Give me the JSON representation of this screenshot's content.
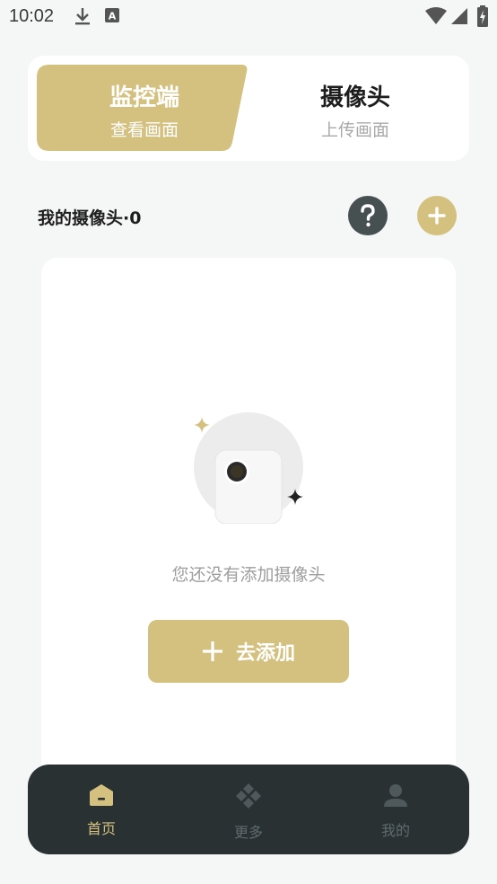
{
  "status_bar": {
    "time": "10:02",
    "icons": [
      "download-icon",
      "keyboard-a-icon",
      "wifi-icon",
      "signal-icon",
      "battery-charging-icon"
    ]
  },
  "mode_switch": {
    "monitor": {
      "title": "监控端",
      "subtitle": "查看画面"
    },
    "camera": {
      "title": "摄像头",
      "subtitle": "上传画面"
    }
  },
  "section": {
    "title": "我的摄像头·0",
    "help_icon": "question-icon",
    "add_icon": "plus-icon"
  },
  "empty_state": {
    "message": "您还没有添加摄像头",
    "add_button": "去添加"
  },
  "bottom_nav": {
    "items": [
      {
        "label": "首页",
        "icon": "home-icon",
        "active": true
      },
      {
        "label": "更多",
        "icon": "diamond-grid-icon",
        "active": false
      },
      {
        "label": "我的",
        "icon": "user-icon",
        "active": false
      }
    ]
  },
  "colors": {
    "accent": "#d4c07f",
    "dark": "#2a3133",
    "help_button": "#475051",
    "background": "#f5f6f6"
  }
}
